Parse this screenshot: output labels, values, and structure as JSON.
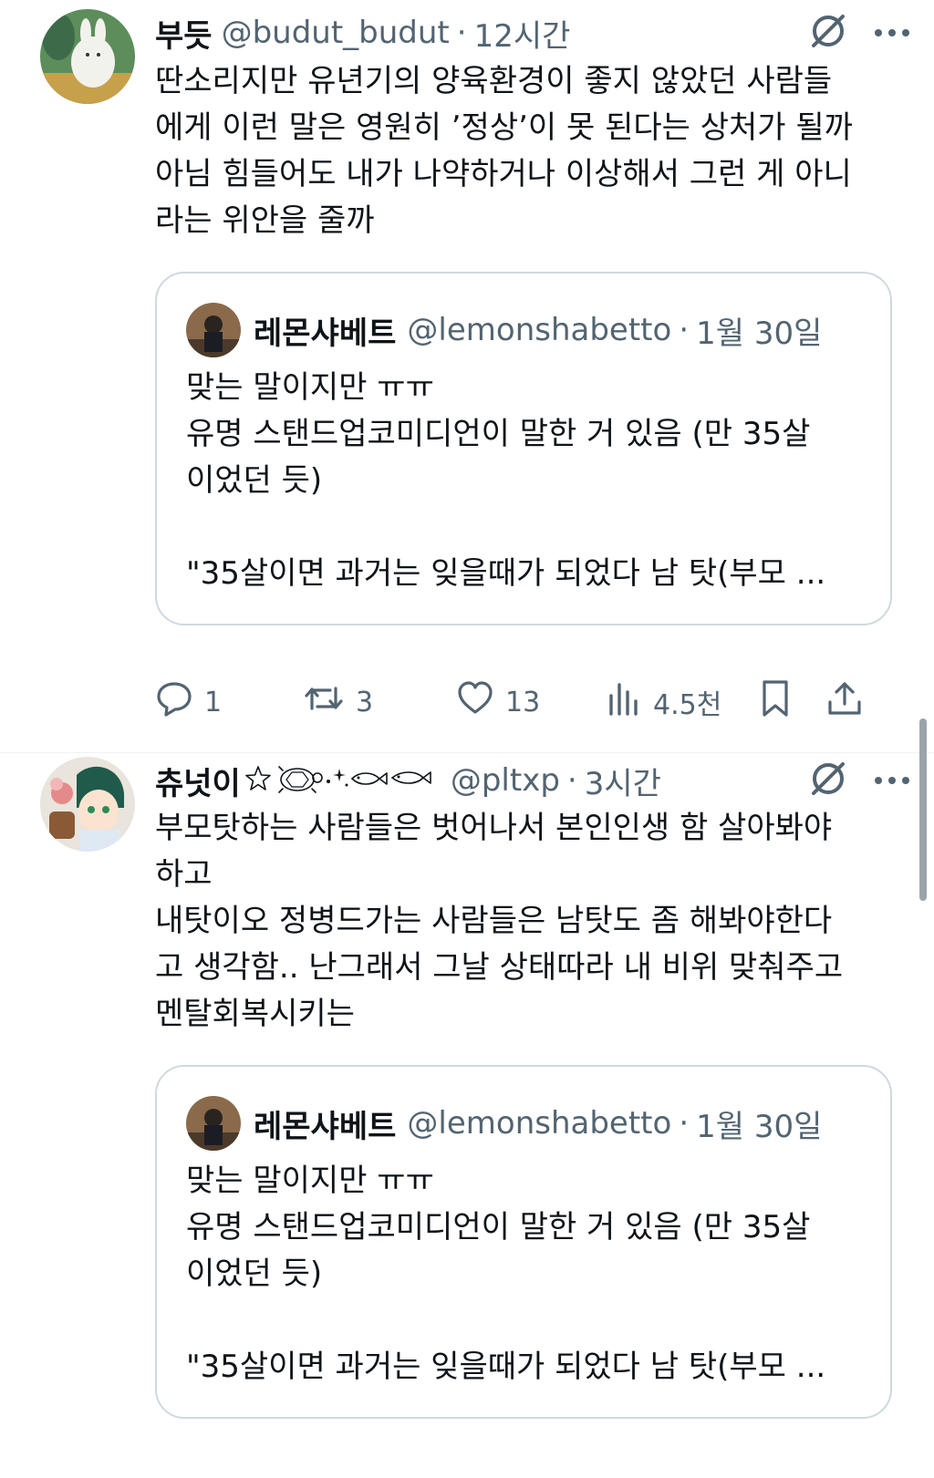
{
  "tweets": [
    {
      "author": {
        "name": "부듯",
        "handle": "@budut_budut",
        "time": "12시간"
      },
      "text": "딴소리지만 유년기의 양육환경이 좋지 않았던 사람들\n에게 이런 말은 영원히 ’정상’이 못 된다는 상처가 될까\n아님 힘들어도 내가 나약하거나 이상해서 그런 게 아니\n라는 위안을 줄까",
      "quote": {
        "name": "레몬샤베트",
        "handle": "@lemonshabetto",
        "time": "1월 30일",
        "text": "맞는 말이지만 ㅠㅠ\n유명 스탠드업코미디언이 말한 거 있음 (만 35살\n이었던 듯)\n\n\"35살이면 과거는 잊을때가 되었다 남 탓(부모 ..."
      },
      "actions": {
        "reply": "1",
        "retweet": "3",
        "like": "13",
        "views": "4.5천"
      }
    },
    {
      "author": {
        "name": "츄넛이",
        "handle": "@pltxp",
        "time": "3시간"
      },
      "text": "부모탓하는 사람들은 벗어나서 본인인생 함 살아봐야\n하고\n내탓이오 정병드가는 사람들은 남탓도 좀 해봐야한다\n고 생각함.. 난그래서 그날 상태따라 내 비위 맞춰주고\n멘탈회복시키는",
      "quote": {
        "name": "레몬샤베트",
        "handle": "@lemonshabetto",
        "time": "1월 30일",
        "text": "맞는 말이지만 ㅠㅠ\n유명 스탠드업코미디언이 말한 거 있음 (만 35살\n이었던 듯)\n\n\"35살이면 과거는 잊을때가 되었다 남 탓(부모 ..."
      }
    }
  ],
  "header_separator": "·",
  "icons": {
    "header": [
      "grok-slash-icon",
      "more-icon"
    ],
    "actions": [
      "reply-icon",
      "retweet-icon",
      "like-icon",
      "views-icon",
      "bookmark-icon",
      "share-icon"
    ],
    "name_decorations": [
      "star-icon",
      "turtle-icon",
      "sparkle-icon",
      "fish-icon",
      "fish-icon"
    ]
  },
  "colors": {
    "text": "#0f1419",
    "secondary": "#536471",
    "border": "#cfd9de"
  }
}
